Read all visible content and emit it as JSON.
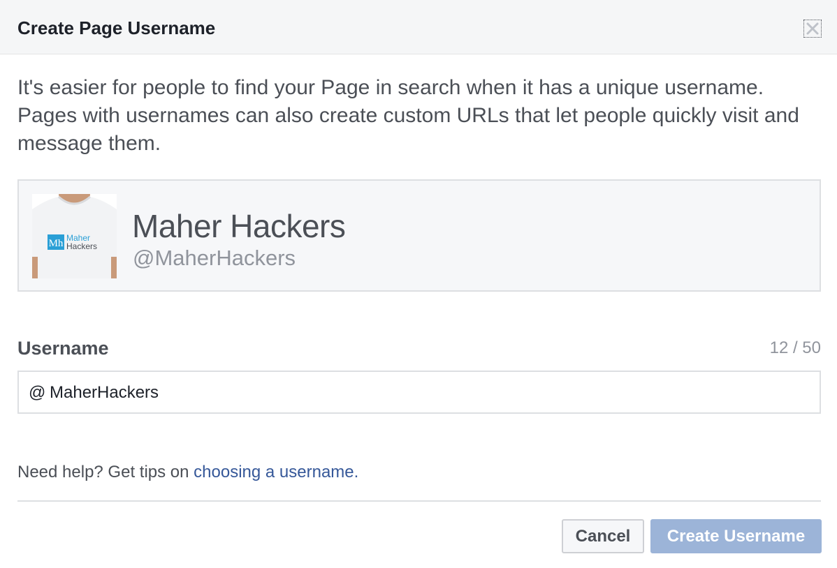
{
  "dialog": {
    "title": "Create Page Username",
    "close_label": "Close"
  },
  "intro": {
    "text": "It's easier for people to find your Page in search when it has a unique username. Pages with usernames can also create custom URLs that let people quickly visit and message them."
  },
  "page": {
    "name": "Maher Hackers",
    "handle": "@MaherHackers",
    "avatar": {
      "logo_mark": "Mh",
      "logo_line1": "Maher",
      "logo_line2": "Hackers"
    }
  },
  "username_field": {
    "label": "Username",
    "char_count": "12 / 50",
    "prefix": "@",
    "value": "MaherHackers"
  },
  "help": {
    "prefix": "Need help? Get tips on ",
    "link_text": "choosing a username",
    "suffix": "."
  },
  "buttons": {
    "cancel": "Cancel",
    "create": "Create Username"
  },
  "colors": {
    "header_bg": "#f5f6f7",
    "link": "#365899",
    "primary_disabled": "#9cb4d8",
    "logo_blue": "#2a9fd6"
  },
  "icons": {
    "close": "close-icon"
  }
}
